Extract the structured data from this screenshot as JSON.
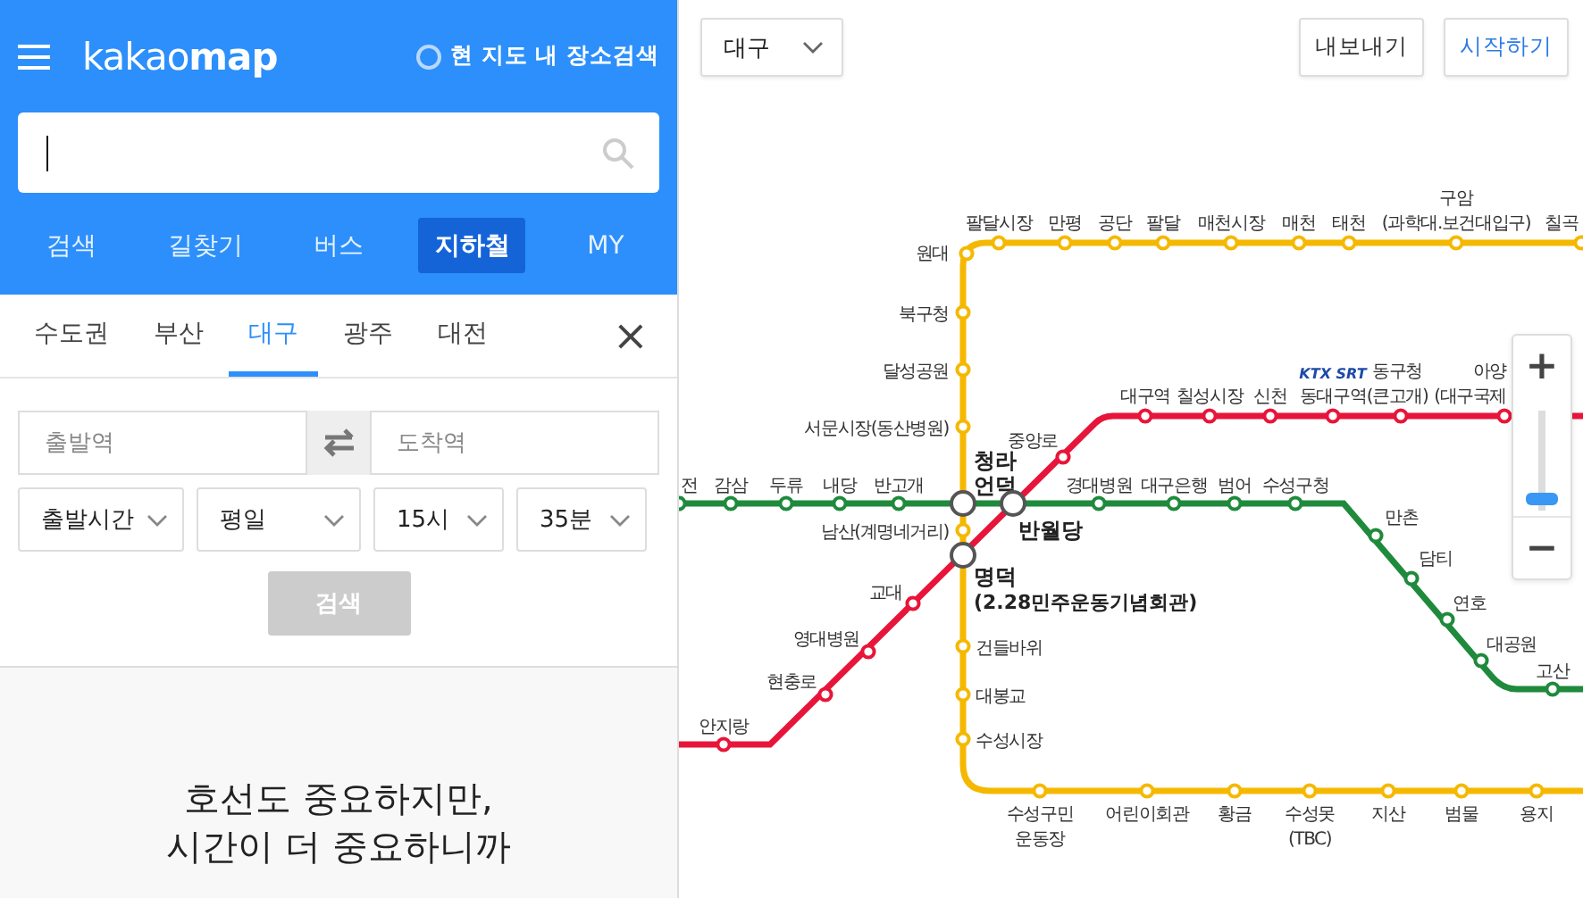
{
  "sidebar": {
    "logo": "kakao**map**",
    "area_search": {
      "label": "현 지도 내 장소검색",
      "checked": false
    },
    "nav_tabs": [
      {
        "label": "검색",
        "selected": false
      },
      {
        "label": "길찾기",
        "selected": false
      },
      {
        "label": "버스",
        "selected": false
      },
      {
        "label": "지하철",
        "selected": true
      },
      {
        "label": "MY",
        "selected": false
      }
    ],
    "city_tabs": [
      {
        "label": "수도권",
        "selected": false
      },
      {
        "label": "부산",
        "selected": false
      },
      {
        "label": "대구",
        "selected": true
      },
      {
        "label": "광주",
        "selected": false
      },
      {
        "label": "대전",
        "selected": false
      }
    ],
    "close": "×",
    "route_form": {
      "departure_placeholder": "출발역",
      "arrival_placeholder": "도착역",
      "selects": [
        {
          "value": "출발시간"
        },
        {
          "value": "평일"
        },
        {
          "value": "15시"
        },
        {
          "value": "35분"
        }
      ],
      "search_button": {
        "label": "검색",
        "disabled": true
      }
    },
    "promo": {
      "lines": [
        "호선도 중요하지만,",
        "시간이 더 중요하니까"
      ]
    }
  },
  "map": {
    "city_select": "대구",
    "buttons": [
      {
        "label": "내보내기",
        "kind": "default"
      },
      {
        "label": "시작하기",
        "kind": "primary"
      }
    ],
    "lines": [
      {
        "color": "#f5b800",
        "stations": [
          {
            "name": [
              "원대"
            ]
          },
          {
            "name": [
              "팔달시장"
            ]
          },
          {
            "name": [
              "만평"
            ]
          },
          {
            "name": [
              "공단"
            ]
          },
          {
            "name": [
              "팔달"
            ]
          },
          {
            "name": [
              "매천시장"
            ]
          },
          {
            "name": [
              "매천"
            ]
          },
          {
            "name": [
              "태천"
            ]
          },
          {
            "name": [
              "구암",
              "(과학대.보건대입구)"
            ]
          },
          {
            "name": [
              "칠곡"
            ]
          },
          {
            "name": [
              "북구청"
            ]
          },
          {
            "name": [
              "달성공원"
            ]
          },
          {
            "name": [
              "서문시장(동산병원)"
            ]
          },
          {
            "name": [
              "남산(계명네거리)"
            ]
          },
          {
            "name": [
              "건들바위"
            ]
          },
          {
            "name": [
              "대봉교"
            ]
          },
          {
            "name": [
              "수성시장"
            ]
          },
          {
            "name": [
              "수성구민",
              "운동장"
            ]
          },
          {
            "name": [
              "어린이회관"
            ]
          },
          {
            "name": [
              "황금"
            ]
          },
          {
            "name": [
              "수성못",
              "(TBC)"
            ]
          },
          {
            "name": [
              "지산"
            ]
          },
          {
            "name": [
              "범물"
            ]
          },
          {
            "name": [
              "용지"
            ]
          }
        ]
      },
      {
        "color": "#e8153a",
        "stations": [
          {
            "name": [
              "대구역"
            ]
          },
          {
            "name": [
              "칠성시장"
            ]
          },
          {
            "name": [
              "신천"
            ]
          },
          {
            "name": [
              "동대구역"
            ],
            "badge": "KTX SRT"
          },
          {
            "name": [
              "동구청",
              "(큰고개)"
            ]
          },
          {
            "name": [
              "아양",
              "(대구국제"
            ]
          },
          {
            "name": [
              "중앙로"
            ]
          },
          {
            "name": [
              "교대"
            ]
          },
          {
            "name": [
              "영대병원"
            ]
          },
          {
            "name": [
              "현충로"
            ]
          },
          {
            "name": [
              "안지랑"
            ]
          }
        ]
      },
      {
        "color": "#1f8a3c",
        "stations": [
          {
            "name": [
              "전"
            ]
          },
          {
            "name": [
              "감삼"
            ]
          },
          {
            "name": [
              "두류"
            ]
          },
          {
            "name": [
              "내당"
            ]
          },
          {
            "name": [
              "반고개"
            ]
          },
          {
            "name": [
              "경대병원"
            ]
          },
          {
            "name": [
              "대구은행"
            ]
          },
          {
            "name": [
              "범어"
            ]
          },
          {
            "name": [
              "수성구청"
            ]
          },
          {
            "name": [
              "만촌"
            ]
          },
          {
            "name": [
              "담티"
            ]
          },
          {
            "name": [
              "연호"
            ]
          },
          {
            "name": [
              "대공원"
            ]
          },
          {
            "name": [
              "고산"
            ]
          }
        ]
      }
    ],
    "transfers": [
      {
        "name": [
          "청라",
          "언덕"
        ]
      },
      {
        "name": [
          "반월당"
        ]
      },
      {
        "name": [
          "명덕",
          "(2.28민주운동기념회관)"
        ]
      }
    ],
    "zoom": {
      "zoom_in": "+",
      "zoom_out": "−",
      "level": 0.1
    }
  }
}
